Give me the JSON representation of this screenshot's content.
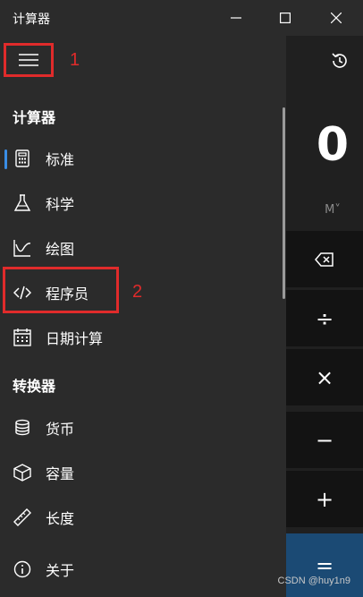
{
  "window": {
    "title": "计算器"
  },
  "display": {
    "value": "0",
    "memory_label": "M˅"
  },
  "keys": {
    "backspace": "⌫",
    "divide": "÷",
    "multiply": "×",
    "minus": "−",
    "plus": "+",
    "equals": "="
  },
  "annotations": {
    "marker_1": "1",
    "marker_2": "2"
  },
  "nav": {
    "section_calculator": "计算器",
    "section_converter": "转换器",
    "items": [
      {
        "label": "标准",
        "icon": "standard-calculator-icon",
        "selected": true
      },
      {
        "label": "科学",
        "icon": "flask-icon"
      },
      {
        "label": "绘图",
        "icon": "graph-icon"
      },
      {
        "label": "程序员",
        "icon": "code-icon"
      },
      {
        "label": "日期计算",
        "icon": "calendar-icon"
      },
      {
        "label": "货币",
        "icon": "coins-icon"
      },
      {
        "label": "容量",
        "icon": "cube-icon"
      },
      {
        "label": "长度",
        "icon": "ruler-icon"
      }
    ],
    "about": {
      "label": "关于",
      "icon": "info-icon"
    }
  },
  "watermark": "CSDN @huy1n9",
  "colors": {
    "accent": "#3a8ee6",
    "annotation_red": "#e02b2b",
    "equals_key": "#1b4a74"
  }
}
